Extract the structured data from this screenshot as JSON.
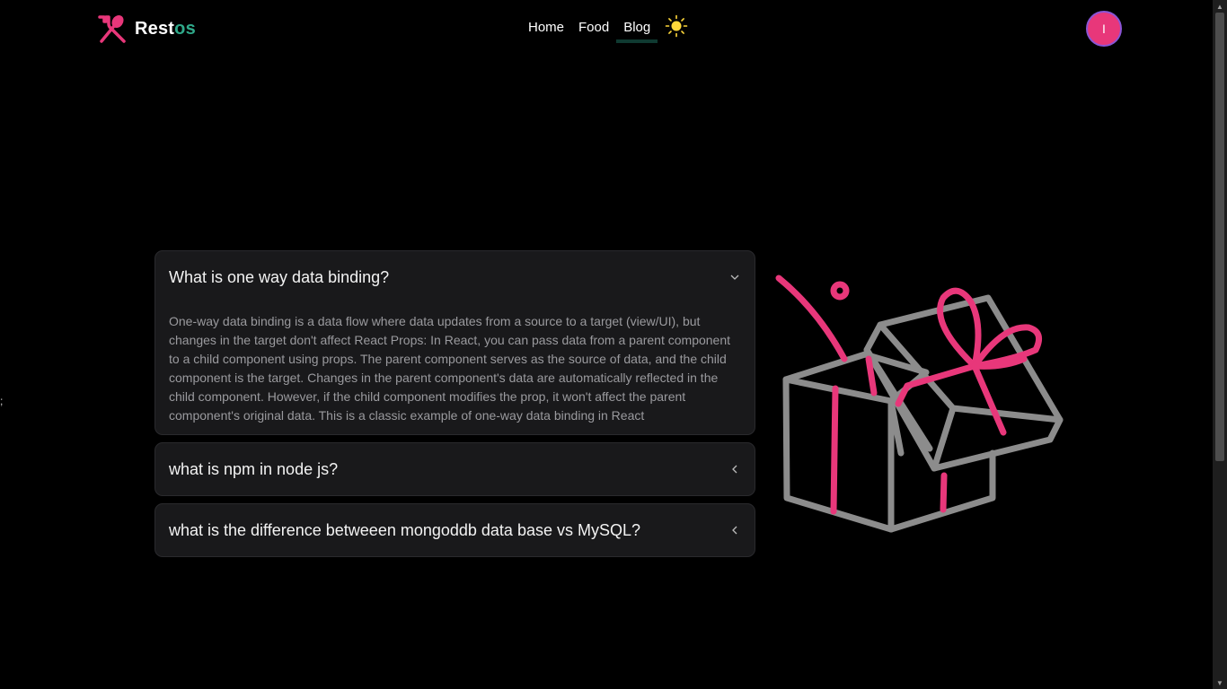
{
  "nav": {
    "brand_main": "Rest",
    "brand_accent": "os",
    "links": [
      {
        "label": "Home"
      },
      {
        "label": "Food"
      },
      {
        "label": "Blog"
      }
    ],
    "theme_icon": "sun-icon",
    "avatar_initial": "I"
  },
  "stray_text": ";",
  "faq": {
    "items": [
      {
        "question": "What is one way data binding?",
        "answer": "One-way data binding is a data flow where data updates from a source to a target (view/UI), but changes in the target don't affect React Props: In React, you can pass data from a parent component to a child component using props. The parent component serves as the source of data, and the child component is the target. Changes in the parent component's data are automatically reflected in the child component. However, if the child component modifies the prop, it won't affect the parent component's original data. This is a classic example of one-way data binding in React",
        "expanded": true
      },
      {
        "question": "what is npm in node js?",
        "expanded": false
      },
      {
        "question": "what is the difference betweeen mongoddb data base vs MySQL?",
        "expanded": false
      }
    ]
  },
  "colors": {
    "background": "#000000",
    "brand_accent": "#2fa98a",
    "brand_pink": "#e8377a",
    "gift_gray": "#8c8c8c",
    "card_bg": "#19191b",
    "active_underline": "#0f3a31"
  },
  "icons": {
    "logo": "fork-spoon-icon",
    "chevron_open": "chevron-down-icon",
    "chevron_closed": "chevron-left-icon",
    "illustration": "gift-box-illustration"
  }
}
